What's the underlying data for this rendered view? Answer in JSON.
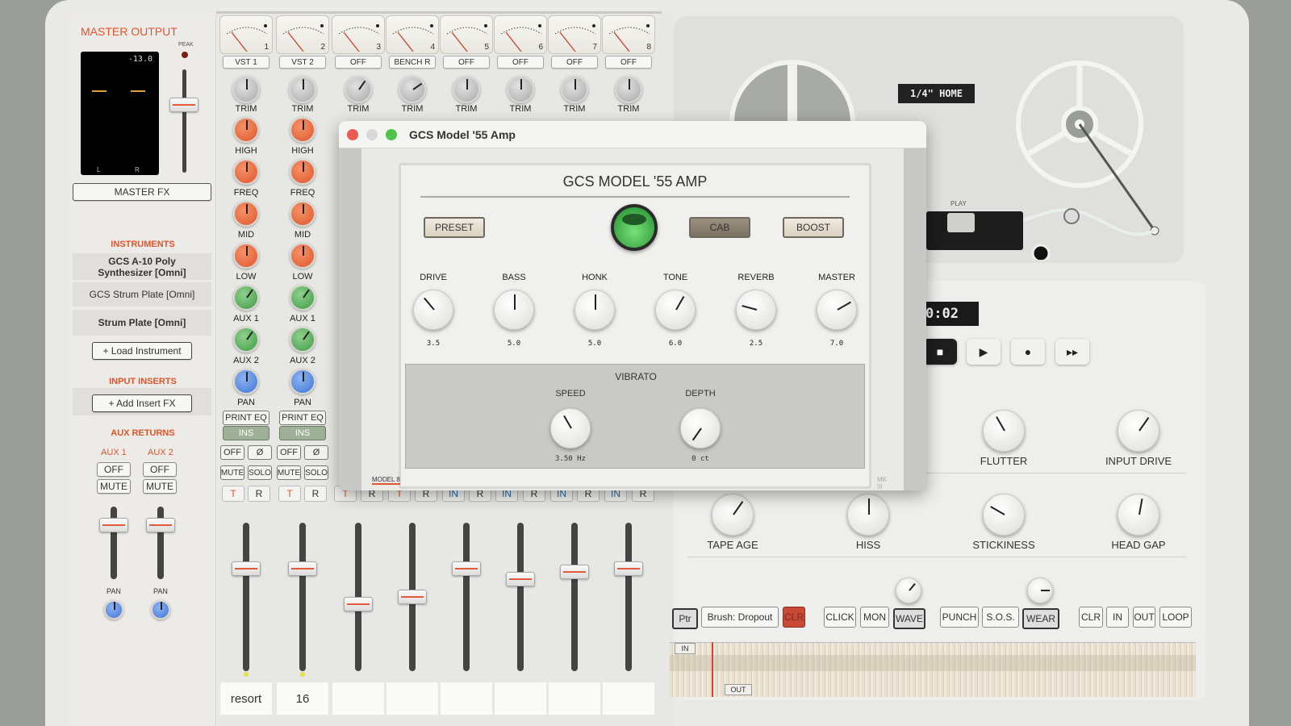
{
  "left_panel": {
    "master_title": "MASTER OUTPUT",
    "peak_label": "PEAK",
    "meter_value": "-13.0",
    "meter_left": "L",
    "meter_right": "R",
    "master_fx": "MASTER FX",
    "instruments_title": "INSTRUMENTS",
    "instruments": [
      "GCS A-10 Poly Synthesizer [Omni]",
      "GCS Strum Plate [Omni]",
      "Strum Plate [Omni]"
    ],
    "load_instrument": "+ Load Instrument",
    "input_inserts_title": "INPUT INSERTS",
    "add_insert": "+ Add Insert FX",
    "aux_returns_title": "AUX RETURNS",
    "aux": [
      {
        "name": "AUX 1",
        "off": "OFF",
        "mute": "MUTE",
        "pan": "PAN"
      },
      {
        "name": "AUX 2",
        "off": "OFF",
        "mute": "MUTE",
        "pan": "PAN"
      }
    ]
  },
  "mixer": {
    "channels": [
      {
        "num": "1",
        "input": "VST 1",
        "name": "resort"
      },
      {
        "num": "2",
        "input": "VST 2",
        "name": "16"
      },
      {
        "num": "3",
        "input": "OFF",
        "name": ""
      },
      {
        "num": "4",
        "input": "BENCH R",
        "name": ""
      },
      {
        "num": "5",
        "input": "OFF",
        "name": ""
      },
      {
        "num": "6",
        "input": "OFF",
        "name": ""
      },
      {
        "num": "7",
        "input": "OFF",
        "name": ""
      },
      {
        "num": "8",
        "input": "OFF",
        "name": ""
      }
    ],
    "labels": {
      "trim": "TRIM",
      "high": "HIGH",
      "freq": "FREQ",
      "mid": "MID",
      "low": "LOW",
      "aux1": "AUX 1",
      "aux2": "AUX 2",
      "pan": "PAN"
    },
    "print_eq": "PRINT EQ",
    "ins": "INS",
    "off": "OFF",
    "phase": "Ø",
    "mute": "MUTE",
    "solo": "SOLO",
    "t": "T",
    "r": "R",
    "in": "IN",
    "row_states": [
      "T",
      "R",
      "T",
      "R",
      "T",
      "R",
      "T",
      "R",
      "IN",
      "R",
      "IN",
      "R",
      "IN",
      "R",
      "IN",
      "R",
      "IN",
      "R"
    ],
    "fader_levels": [
      0.74,
      0.74,
      0.5,
      0.55,
      0.74,
      0.67,
      0.72,
      0.74
    ]
  },
  "amp_window": {
    "title": "GCS Model '55 Amp",
    "header": "GCS MODEL '55 AMP",
    "preset": "PRESET",
    "cab": "CAB",
    "boost": "BOOST",
    "knobs": [
      {
        "label": "DRIVE",
        "value": "3.5"
      },
      {
        "label": "BASS",
        "value": "5.0"
      },
      {
        "label": "HONK",
        "value": "5.0"
      },
      {
        "label": "TONE",
        "value": "6.0"
      },
      {
        "label": "REVERB",
        "value": "2.5"
      },
      {
        "label": "MASTER",
        "value": "7.0"
      }
    ],
    "vibrato_title": "VIBRATO",
    "speed_label": "SPEED",
    "speed_value": "3.50 Hz",
    "depth_label": "DEPTH",
    "depth_value": "0 ct",
    "footer_left": "MODEL 8",
    "footer_right": "MK III"
  },
  "tape": {
    "reel_label": "1/4\" HOME",
    "play_label": "PLAY",
    "time": "0:02",
    "knobs": [
      "FLUTTER",
      "INPUT DRIVE",
      "TAPE AGE",
      "HISS",
      "STICKINESS",
      "HEAD GAP"
    ],
    "buttons": [
      "Ptr",
      "Brush: Dropout",
      "CLR",
      "CLICK",
      "MON",
      "WAVE",
      "PUNCH",
      "S.O.S.",
      "WEAR",
      "CLR",
      "IN",
      "OUT",
      "LOOP"
    ],
    "in_marker": "IN",
    "out_marker": "OUT"
  },
  "colors": {
    "accent": "#e0552a",
    "knob_orange": "#e0552a",
    "knob_green": "#3f9c47",
    "knob_blue": "#3c75d6",
    "clr_red": "#c84a36"
  }
}
